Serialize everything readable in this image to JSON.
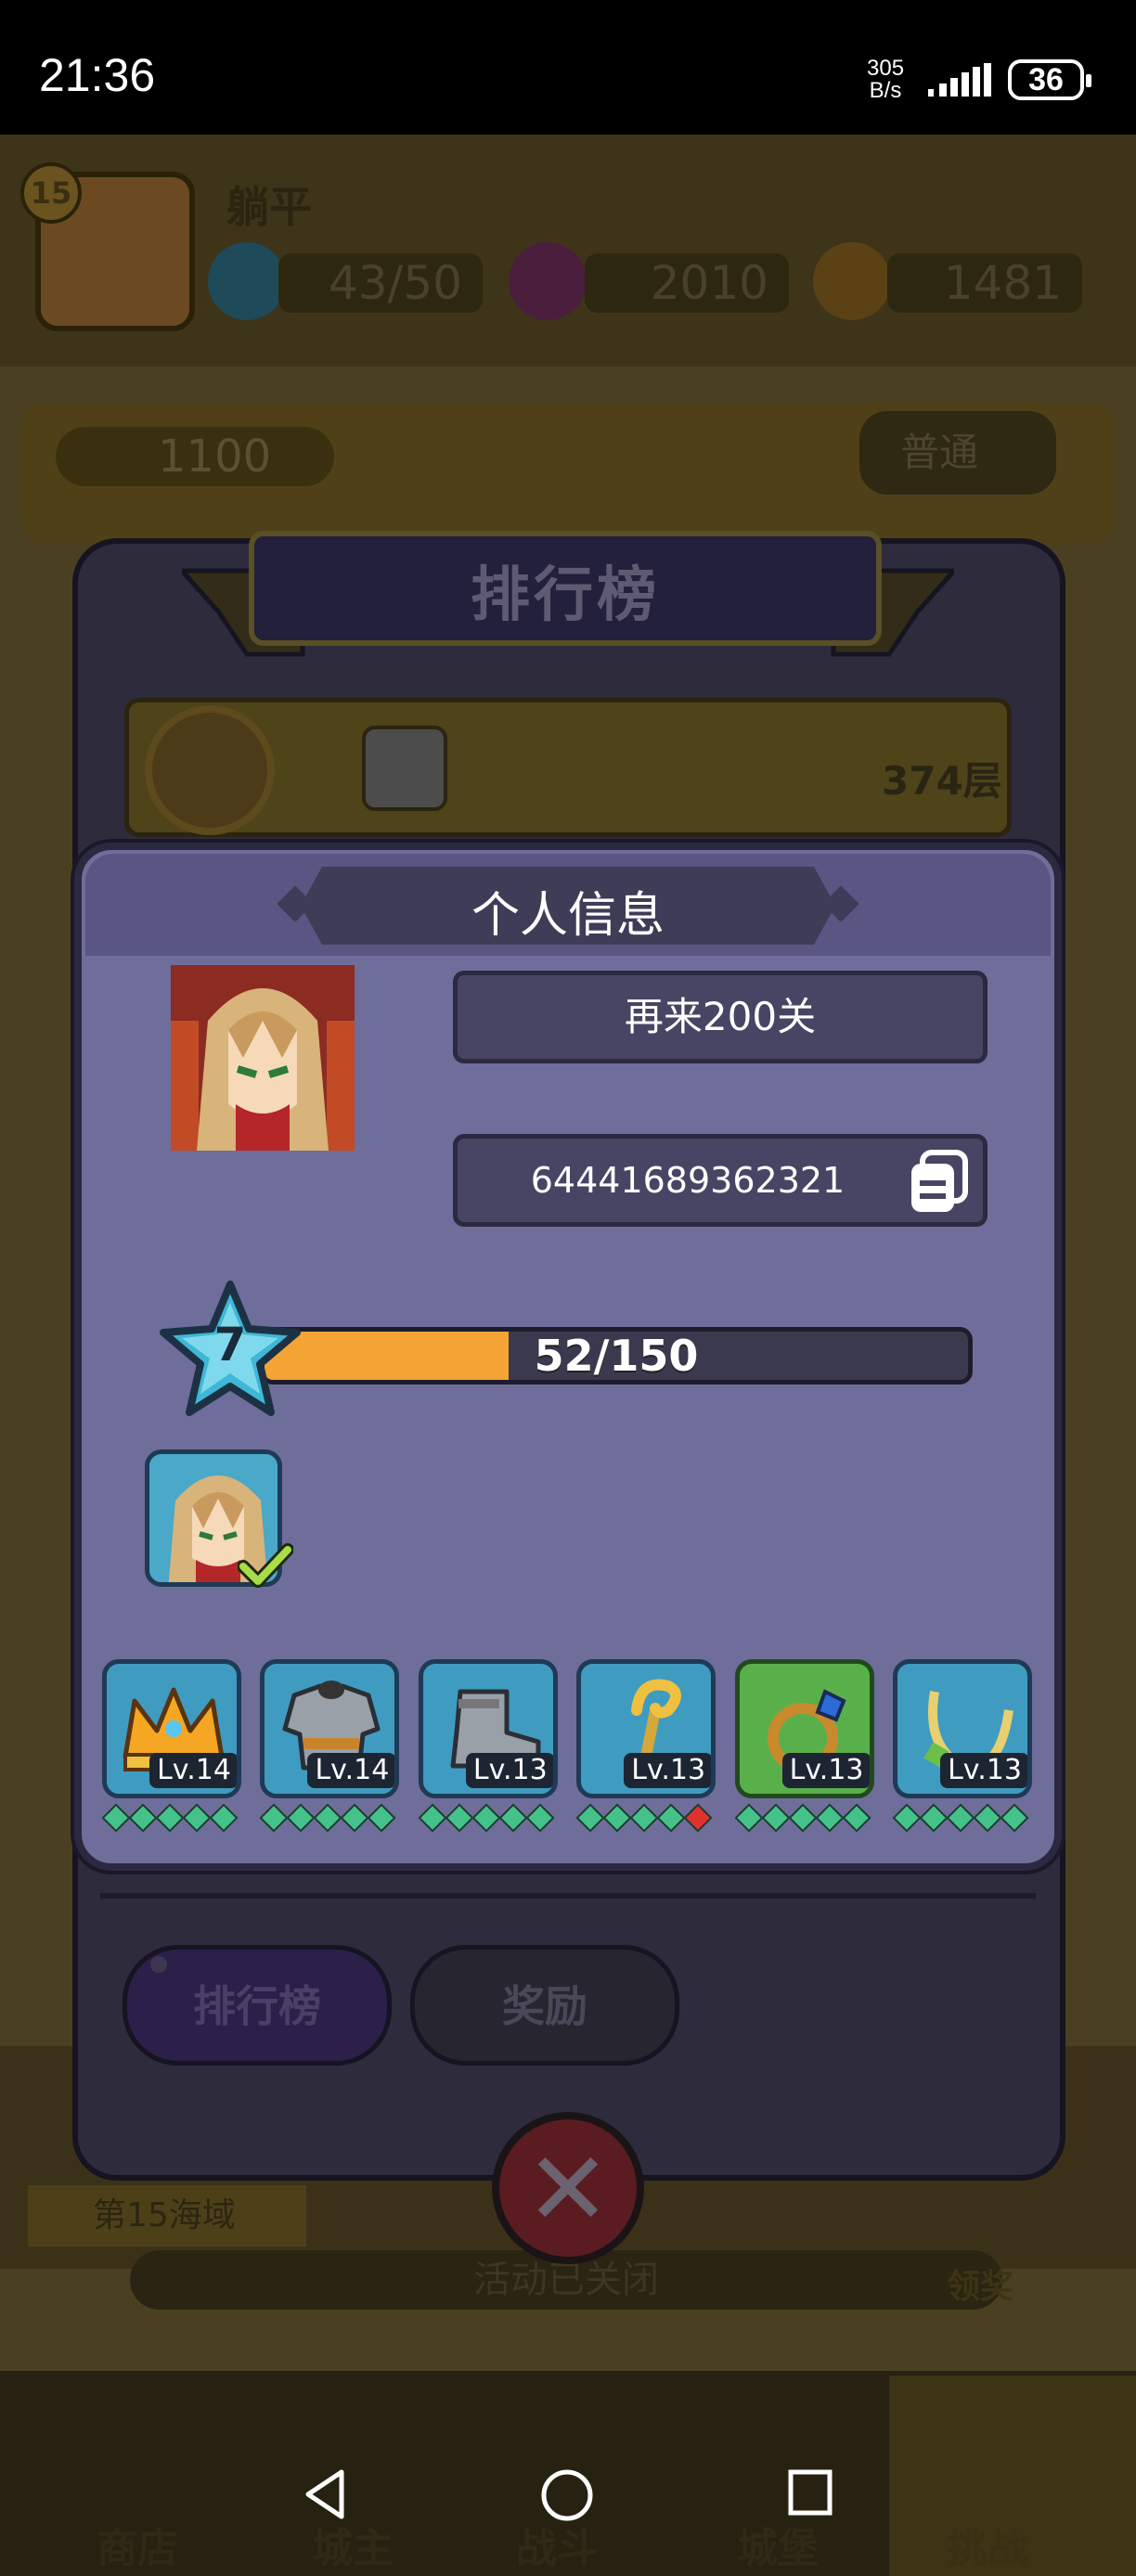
{
  "status_bar": {
    "time": "21:36",
    "net_speed_top": "305",
    "net_speed_bottom": "B/s",
    "battery": "36"
  },
  "background": {
    "player_level": "15",
    "player_name": "躺平",
    "energy": "43/50",
    "gems": "2010",
    "coins": "1481",
    "banner_coin": "1100",
    "mode": "普通",
    "event_tag": "第15海域",
    "event_status": "活动已关闭",
    "claim_label": "领奖",
    "nav": [
      "商店",
      "城主",
      "战斗",
      "城堡",
      "挑战"
    ]
  },
  "leaderboard": {
    "title": "排行榜",
    "top_floor": "374层",
    "tabs": [
      "排行榜",
      "奖励"
    ]
  },
  "personal_info": {
    "title": "个人信息",
    "nickname": "再来200关",
    "uid": "64441689362321",
    "level": "7",
    "xp_text": "52/150",
    "xp_fraction": 0.3467,
    "equipment": [
      {
        "icon": "crown-icon",
        "level": "Lv.14",
        "bg": "blue",
        "pips": [
          "g",
          "g",
          "g",
          "g",
          "g"
        ]
      },
      {
        "icon": "armor-icon",
        "level": "Lv.14",
        "bg": "blue",
        "pips": [
          "g",
          "g",
          "g",
          "g",
          "g"
        ]
      },
      {
        "icon": "boot-icon",
        "level": "Lv.13",
        "bg": "blue",
        "pips": [
          "g",
          "g",
          "g",
          "g",
          "g"
        ]
      },
      {
        "icon": "staff-icon",
        "level": "Lv.13",
        "bg": "blue",
        "pips": [
          "g",
          "g",
          "g",
          "g",
          "r"
        ]
      },
      {
        "icon": "ring-icon",
        "level": "Lv.13",
        "bg": "green",
        "pips": [
          "g",
          "g",
          "g",
          "g",
          "g"
        ]
      },
      {
        "icon": "necklace-icon",
        "level": "Lv.13",
        "bg": "blue",
        "pips": [
          "g",
          "g",
          "g",
          "g",
          "g"
        ]
      }
    ]
  },
  "colors": {
    "panel": "#6f6d9a",
    "xp_fill": "#f4a335",
    "equip_blue": "#3f9cc0",
    "equip_green": "#59b04a",
    "pip_green": "#45c18a",
    "pip_red": "#e0312f"
  }
}
